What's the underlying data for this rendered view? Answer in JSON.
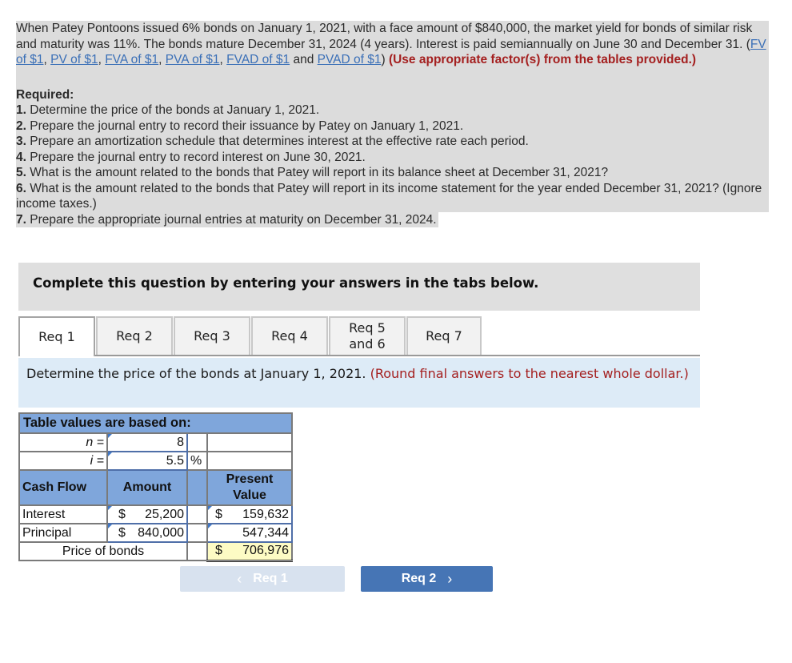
{
  "problem": {
    "intro_text_1": "When Patey Pontoons issued 6% bonds on January 1, 2021, with a face amount of $840,000, the market yield for bonds of similar risk and maturity was 11%. The bonds mature December 31, 2024 (4 years). Interest is paid semiannually on June 30 and December 31. (",
    "links": [
      "FV of $1",
      "PV of $1",
      "FVA of $1",
      "PVA of $1",
      "FVAD of $1",
      "PVAD of $1"
    ],
    "link_sep_comma": ", ",
    "link_sep_and": " and ",
    "close_paren": ")",
    "instruction_red": " (Use appropriate factor(s) from the tables provided.)",
    "required_title": "Required:",
    "requirements": [
      {
        "num": "1.",
        "text": " Determine the price of the bonds at January 1, 2021."
      },
      {
        "num": "2.",
        "text": " Prepare the journal entry to record their issuance by Patey on January 1, 2021."
      },
      {
        "num": "3.",
        "text": " Prepare an amortization schedule that determines interest at the effective rate each period."
      },
      {
        "num": "4.",
        "text": " Prepare the journal entry to record interest on June 30, 2021."
      },
      {
        "num": "5.",
        "text": " What is the amount related to the bonds that Patey will report in its balance sheet at December 31, 2021?"
      },
      {
        "num": "6.",
        "text": " What is the amount related to the bonds that Patey will report in its income statement for the year ended December 31, 2021? (Ignore income taxes.)"
      },
      {
        "num": "7.",
        "text": " Prepare the appropriate journal entries at maturity on December 31, 2024."
      }
    ]
  },
  "banner": {
    "text": "Complete this question by entering your answers in the tabs below."
  },
  "tabs": [
    {
      "label": "Req 1",
      "active": true
    },
    {
      "label": "Req 2",
      "active": false
    },
    {
      "label": "Req 3",
      "active": false
    },
    {
      "label": "Req 4",
      "active": false
    },
    {
      "label_line1": "Req 5",
      "label_line2": "and 6",
      "active": false
    },
    {
      "label": "Req 7",
      "active": false
    }
  ],
  "instruction": {
    "text": "Determine the price of the bonds at January 1, 2021. ",
    "note_red": "(Round final answers to the nearest whole dollar.)"
  },
  "worksheet": {
    "title": "Table values are based on:",
    "n_label": "n =",
    "n_value": "8",
    "i_label": "i =",
    "i_value": "5.5",
    "i_unit": "%",
    "headers": {
      "cash_flow": "Cash Flow",
      "amount": "Amount",
      "pv_line1": "Present",
      "pv_line2": "Value"
    },
    "rows": [
      {
        "label": "Interest",
        "amount_sign": "$",
        "amount": "25,200",
        "pv_sign": "$",
        "pv": "159,632"
      },
      {
        "label": "Principal",
        "amount_sign": "$",
        "amount": "840,000",
        "pv_sign": "",
        "pv": "547,344"
      }
    ],
    "total_label": "Price of bonds",
    "total_sign": "$",
    "total_value": "706,976"
  },
  "nav": {
    "prev_label": "Req 1",
    "next_label": "Req 2",
    "prev_icon": "‹",
    "next_icon": "›",
    "prev_disabled": true
  },
  "colors": {
    "link": "#3a6fb7",
    "red_note": "#a41f1f",
    "worksheet_header": "#7fa6db",
    "total_highlight": "#fdfbc4",
    "next_button": "#4675b5",
    "prev_button_disabled": "#d8e2ef"
  }
}
